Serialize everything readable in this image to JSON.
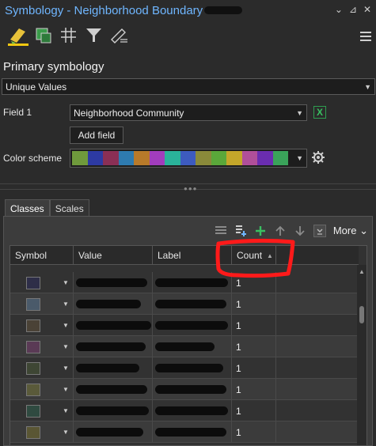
{
  "window": {
    "title": "Symbology - Neighborhood Boundary",
    "controls": [
      "⌄",
      "⊿",
      "✕"
    ]
  },
  "toolbar": {
    "tools": [
      {
        "name": "primary-symbology-tool",
        "active": true
      },
      {
        "name": "multilayer-tool",
        "active": false
      },
      {
        "name": "vary-symbology-tool",
        "active": false
      },
      {
        "name": "filter-tool",
        "active": false
      },
      {
        "name": "symbol-layer-drawing-tool",
        "active": false
      }
    ]
  },
  "primary": {
    "section_title": "Primary symbology",
    "renderer": "Unique Values",
    "field1_label": "Field 1",
    "field1_value": "Neighborhood Community",
    "add_field": "Add field",
    "color_scheme_label": "Color scheme",
    "color_scheme": [
      "#6f9a3c",
      "#2d3aa3",
      "#8a2f55",
      "#2e7bb0",
      "#b87a2a",
      "#a23dbd",
      "#2ab39a",
      "#3d5bbf",
      "#8a8a3a",
      "#5aa83a",
      "#c4a72a",
      "#b04f9a",
      "#6a2db0",
      "#3aa35a"
    ]
  },
  "tabs": [
    {
      "label": "Classes",
      "active": true
    },
    {
      "label": "Scales",
      "active": false
    }
  ],
  "grid_tools": {
    "more_label": "More",
    "more_caret": "⌄"
  },
  "table": {
    "columns": [
      {
        "label": "Symbol",
        "sort": ""
      },
      {
        "label": "Value",
        "sort": ""
      },
      {
        "label": "Label",
        "sort": ""
      },
      {
        "label": "Count",
        "sort": "▲"
      },
      {
        "label": "",
        "sort": ""
      }
    ],
    "rows": [
      {
        "color": "#2e2e48",
        "count": "1"
      },
      {
        "color": "#4a5a6a",
        "count": "1"
      },
      {
        "color": "#4a4236",
        "count": "1"
      },
      {
        "color": "#5a3a55",
        "count": "1"
      },
      {
        "color": "#3e4634",
        "count": "1"
      },
      {
        "color": "#5a5a3a",
        "count": "1"
      },
      {
        "color": "#2f4a40",
        "count": "1"
      },
      {
        "color": "#5a5634",
        "count": "1"
      }
    ]
  },
  "colors": {
    "title_blue": "#6fb6ff",
    "active_tab_yellow": "#f2c811",
    "annotation_red": "#ff1a1a",
    "add_green": "#39c061"
  }
}
